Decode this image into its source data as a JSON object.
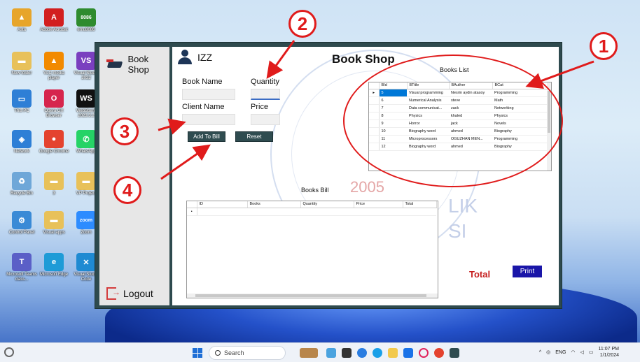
{
  "desktop": {
    "icons": [
      {
        "label": "Asta",
        "color": "#e7a52a",
        "glyph": "▲"
      },
      {
        "label": "Adobe Acrobat",
        "color": "#d21f1f",
        "glyph": "A"
      },
      {
        "label": "emu8086",
        "color": "#2e8b2e",
        "glyph": "8086"
      },
      {
        "label": "New folder",
        "color": "#e8c15a",
        "glyph": "▬"
      },
      {
        "label": "VLC media player",
        "color": "#f28a00",
        "glyph": "▲"
      },
      {
        "label": "Visual Studio 2022",
        "color": "#7a3fbf",
        "glyph": "VS"
      },
      {
        "label": "This PC",
        "color": "#2e7fd6",
        "glyph": "▭"
      },
      {
        "label": "Opera GX Browser",
        "color": "#d6254d",
        "glyph": "O"
      },
      {
        "label": "WebStorm 2023.3.2",
        "color": "#111111",
        "glyph": "WS"
      },
      {
        "label": "Network",
        "color": "#2e7fd6",
        "glyph": "◈"
      },
      {
        "label": "Google Chrome",
        "color": "#e4432f",
        "glyph": "●"
      },
      {
        "label": "WhatsApp",
        "color": "#25d366",
        "glyph": "✆"
      },
      {
        "label": "Recycle Bin",
        "color": "#6fa7d8",
        "glyph": "♻"
      },
      {
        "label": "3",
        "color": "#e8c15a",
        "glyph": "▬"
      },
      {
        "label": "VP Project",
        "color": "#e8c15a",
        "glyph": "▬"
      },
      {
        "label": "Control Panel",
        "color": "#3a8ad6",
        "glyph": "⚙"
      },
      {
        "label": "Visual apps",
        "color": "#e8c15a",
        "glyph": "▬"
      },
      {
        "label": "Zoom",
        "color": "#2d8cff",
        "glyph": "zoom"
      },
      {
        "label": "Microsoft Teams class...",
        "color": "#5b5fc7",
        "glyph": "T"
      },
      {
        "label": "Microsoft Edge",
        "color": "#1e9bd7",
        "glyph": "e"
      },
      {
        "label": "Visual Studio Code",
        "color": "#1f8ad2",
        "glyph": "✕"
      }
    ]
  },
  "app": {
    "brand": "Book Shop",
    "logout": "Logout",
    "user": "IZZ",
    "title": "Book Shop",
    "form": {
      "book_name_label": "Book Name",
      "quantity_label": "Quantity",
      "client_name_label": "Client Name",
      "price_label": "Price",
      "book_name_value": "",
      "quantity_value": "",
      "client_name_value": "",
      "price_value": ""
    },
    "buttons": {
      "add_to_bill": "Add To Bill",
      "reset": "Reset",
      "print": "Print"
    },
    "watermark": {
      "year": "2005",
      "line1": "LIK",
      "line2": "SI"
    },
    "books_list": {
      "title": "Books List",
      "columns": [
        "BId",
        "BTitle",
        "BAuther",
        "BCat"
      ],
      "rows": [
        [
          "5",
          "Visual programming",
          "Nesrin aydin atasoy",
          "Programming"
        ],
        [
          "6",
          "Numerical Analysis",
          "steve",
          "Math"
        ],
        [
          "7",
          "Data communicat...",
          "zack",
          "Networking"
        ],
        [
          "8",
          "Physics",
          "khaled",
          "Physics"
        ],
        [
          "9",
          "Horror",
          "jack",
          "Novels"
        ],
        [
          "10",
          "Biography word",
          "ahmed",
          "Biography"
        ],
        [
          "11",
          "Microprocessors",
          "OGUZHAN MEN...",
          "Programming"
        ],
        [
          "12",
          "Biography word",
          "ahmed",
          "Biography"
        ]
      ]
    },
    "books_bill": {
      "title": "Books Bill",
      "columns": [
        "ID",
        "Books",
        "Quantity",
        "Price",
        "Total"
      ]
    },
    "total_label": "Total"
  },
  "annotations": [
    "1",
    "2",
    "3",
    "4"
  ],
  "taskbar": {
    "search_placeholder": "Search",
    "lang": "ENG",
    "time": "11:07 PM",
    "date": "1/1/2024"
  }
}
